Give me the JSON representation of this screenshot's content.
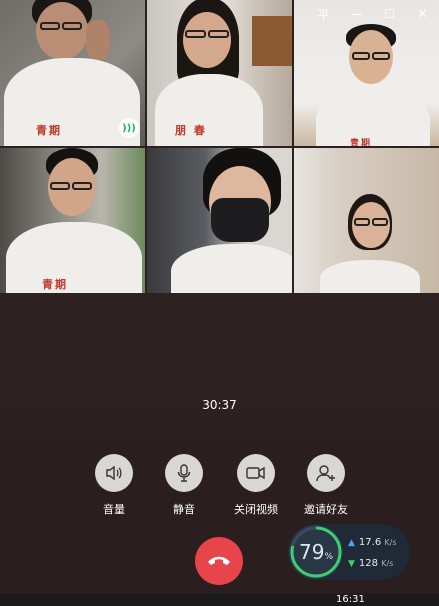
{
  "window": {
    "pin_icon": "pin-icon",
    "minimize_icon": "minimize-icon",
    "maximize_icon": "maximize-icon",
    "close_icon": "close-icon",
    "pin_glyph": "平",
    "minimize_glyph": "—",
    "maximize_glyph": "☐",
    "close_glyph": "✕"
  },
  "call": {
    "duration": "30:37"
  },
  "controls": [
    {
      "label": "音量",
      "icon": "speaker-icon"
    },
    {
      "label": "静音",
      "icon": "microphone-icon"
    },
    {
      "label": "关闭视频",
      "icon": "video-camera-icon"
    },
    {
      "label": "邀请好友",
      "icon": "add-user-icon"
    }
  ],
  "hangup": {
    "icon": "hang-up-icon",
    "color": "#e8454a"
  },
  "network": {
    "percent": "79",
    "percent_unit": "%",
    "upload": "17.6",
    "upload_unit": "K/s",
    "download": "128",
    "download_unit": "K/s"
  },
  "taskbar": {
    "time": "16:31"
  }
}
